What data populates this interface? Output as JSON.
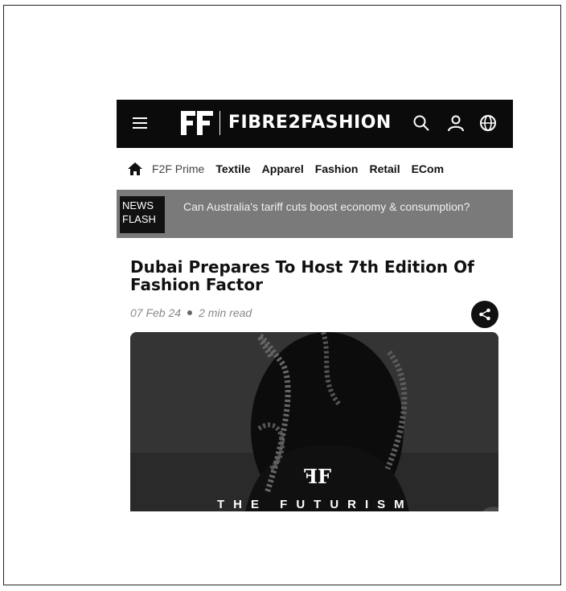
{
  "header": {
    "logo_text": "FIBRE2FASHION",
    "icons": [
      "menu-icon",
      "search-icon",
      "user-icon",
      "globe-icon"
    ]
  },
  "nav": {
    "items": [
      {
        "label": "F2F Prime"
      },
      {
        "label": "Textile"
      },
      {
        "label": "Apparel"
      },
      {
        "label": "Fashion"
      },
      {
        "label": "Retail"
      },
      {
        "label": "ECom"
      }
    ]
  },
  "news_flash": {
    "label_line1": "NEWS",
    "label_line2": "FLASH",
    "text": "Can Australia's tariff cuts boost economy & consumption?"
  },
  "article": {
    "headline": "Dubai Prepares To Host 7th Edition Of Fashion Factor",
    "date": "07 Feb 24",
    "read_time": "2 min read",
    "hero_logo": "ꟻF",
    "hero_title": "THE FUTURISM"
  },
  "colors": {
    "header_bg": "#0b0b0b",
    "newsflash_bg": "#7a7a7a"
  }
}
